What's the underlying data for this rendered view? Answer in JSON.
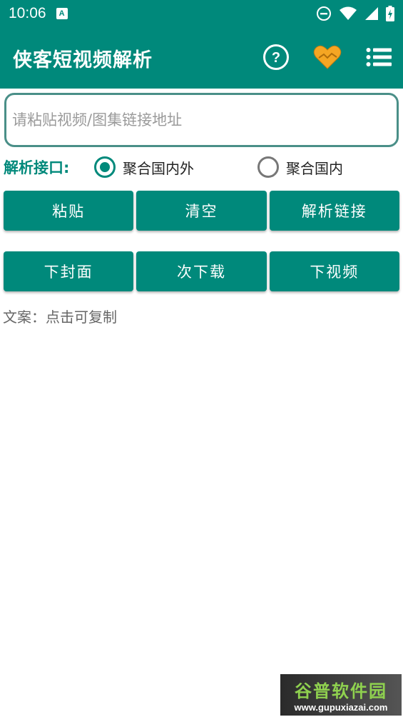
{
  "status_bar": {
    "time": "10:06",
    "notification_letter": "A"
  },
  "app_bar": {
    "title": "侠客短视频解析",
    "icons": [
      "help-icon",
      "heart-icon",
      "menu-list-icon"
    ]
  },
  "input": {
    "placeholder": "请粘贴视频/图集链接地址",
    "value": ""
  },
  "api": {
    "label": "解析接口:",
    "options": [
      {
        "label": "聚合国内外",
        "checked": true
      },
      {
        "label": "聚合国内",
        "checked": false
      }
    ]
  },
  "buttons_row1": [
    "粘贴",
    "清空",
    "解析链接"
  ],
  "buttons_row2": [
    "下封面",
    "次下载",
    "下视频"
  ],
  "caption": "文案：点击可复制",
  "watermark": {
    "title": "谷普软件园",
    "url": "www.gupuxiazai.com"
  },
  "colors": {
    "primary": "#00897b",
    "heart": "#f5a623"
  }
}
